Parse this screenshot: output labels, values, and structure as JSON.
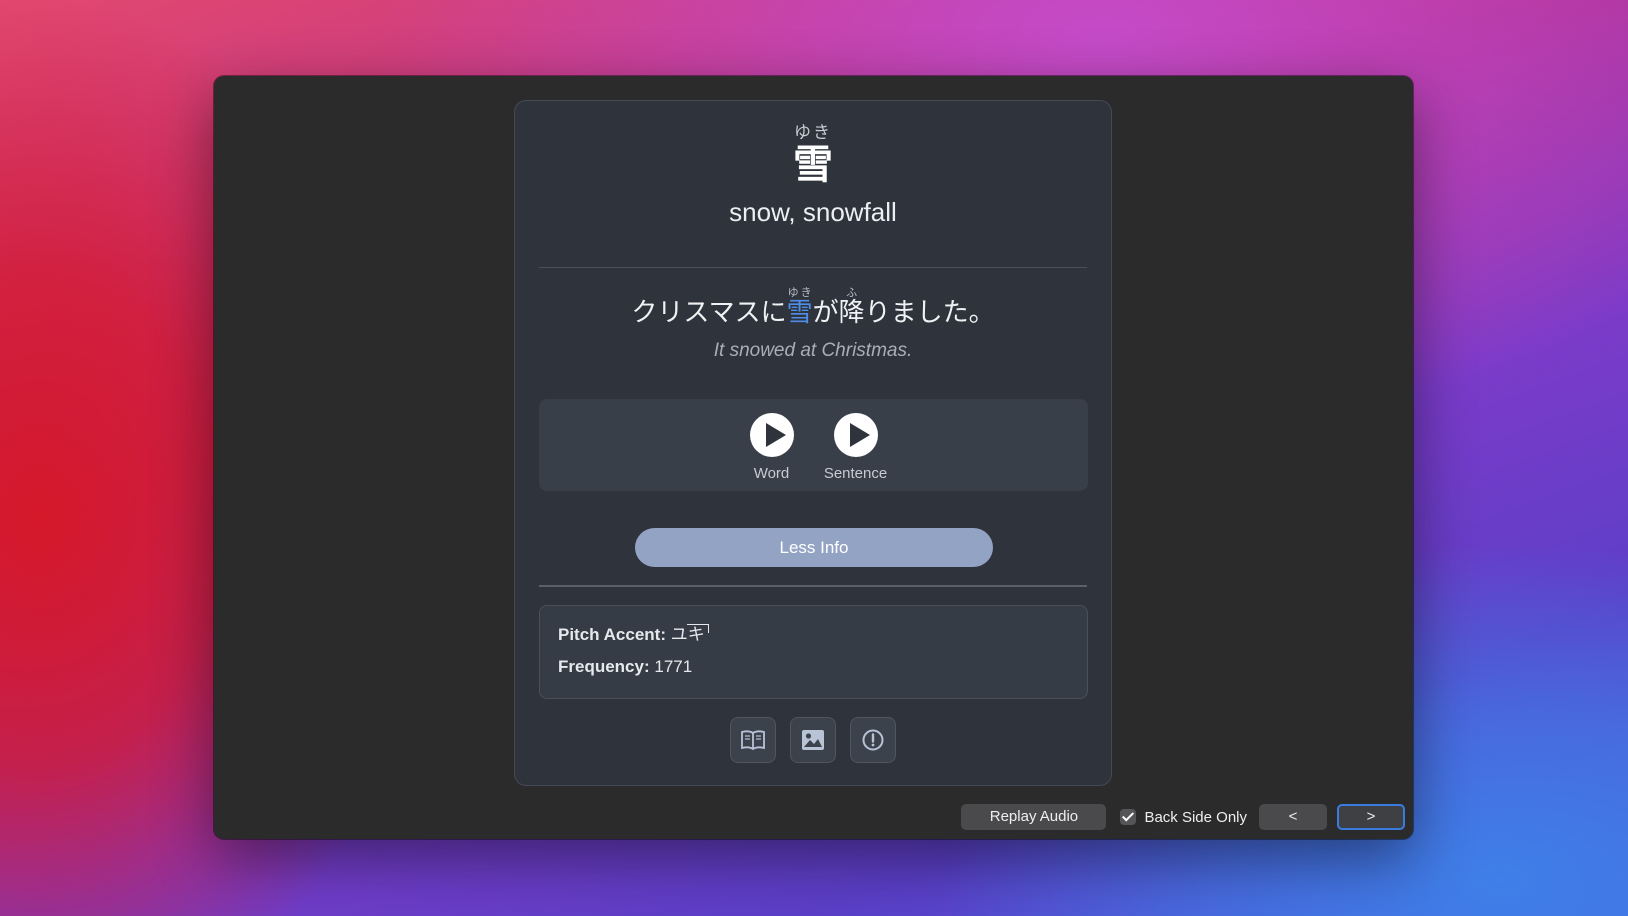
{
  "card": {
    "word_reading": "ゆき",
    "word_kanji": "雪",
    "meaning": "snow, snowfall",
    "sentence": {
      "before": "クリスマスに",
      "target": "雪",
      "target_reading": "ゆき",
      "mid": "が",
      "kanji2": "降",
      "kanji2_reading": "ふ",
      "after": "りました。"
    },
    "translation": "It snowed at Christmas.",
    "audio": {
      "word_label": "Word",
      "sentence_label": "Sentence"
    },
    "less_info_label": "Less Info",
    "info": {
      "pitch_label": "Pitch Accent:",
      "pitch_value": "ユキ",
      "frequency_label": "Frequency:",
      "frequency_value": "1771"
    },
    "icons": [
      "book-icon",
      "image-icon",
      "alert-icon"
    ],
    "highlight_color": "#4f8ee8"
  },
  "toolbar": {
    "replay_label": "Replay Audio",
    "back_side_only_label": "Back Side Only",
    "back_side_only_checked": true,
    "prev_label": "<",
    "next_label": ">"
  }
}
